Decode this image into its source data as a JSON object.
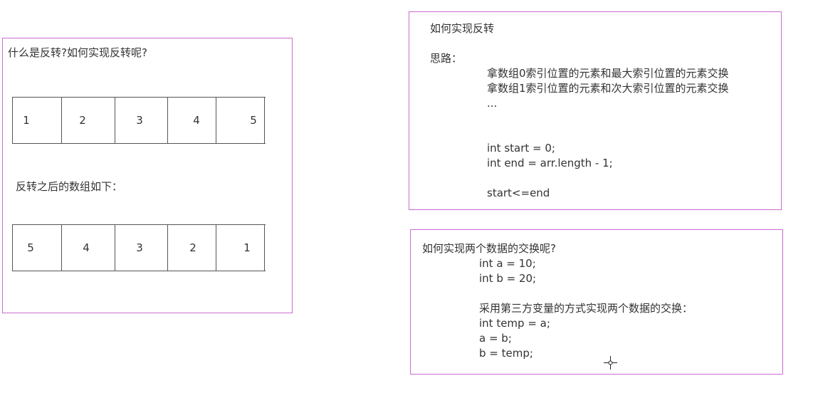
{
  "left_panel": {
    "title": "什么是反转?如何实现反转呢?",
    "original_array": [
      "1",
      "2",
      "3",
      "4",
      "5"
    ],
    "after_label": "反转之后的数组如下：",
    "reversed_array": [
      "5",
      "4",
      "3",
      "2",
      "1"
    ]
  },
  "right_top_panel": {
    "title": "如何实现反转",
    "idea_label": "思路：",
    "lines": [
      "拿数组0索引位置的元素和最大索引位置的元素交换",
      "拿数组1索引位置的元素和次大索引位置的元素交换",
      "...",
      "int start = 0;",
      "int end = arr.length - 1;",
      "start<=end"
    ]
  },
  "right_bottom_panel": {
    "title": "如何实现两个数据的交换呢?",
    "lines": [
      "int a = 10;",
      "int b = 20;",
      "采用第三方变量的方式实现两个数据的交换：",
      "int temp = a;",
      "a = b;",
      "b = temp;"
    ]
  },
  "colors": {
    "frame": "#c86ccf",
    "text": "#333333",
    "grid": "#555555"
  },
  "cursor_icon": "crosshair-cursor-icon"
}
